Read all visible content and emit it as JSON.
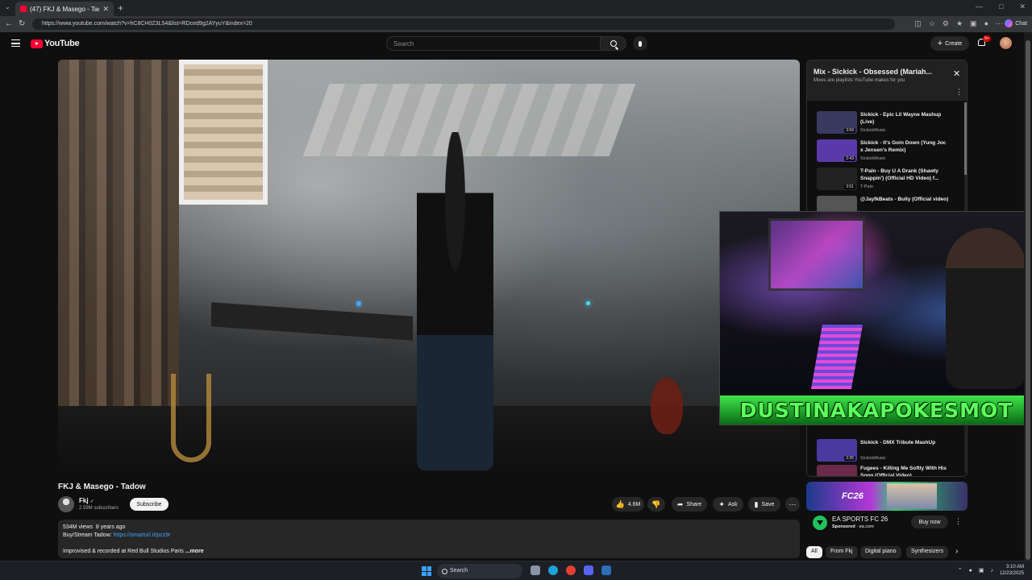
{
  "browser": {
    "tab_title": "(47) FKJ & Masego - Tadow",
    "url": "https://www.youtube.com/watch?v=hC8CH0Z3L54&list=RDced9g2AYyuY&index=20",
    "chat_label": "Chat"
  },
  "header": {
    "logo_text": "YouTube",
    "search_placeholder": "Search",
    "create_label": "Create",
    "notification_count": "9+"
  },
  "video": {
    "title": "FKJ & Masego - Tadow",
    "channel": "Fkj",
    "subscribers": "2.59M subscribers",
    "subscribe_label": "Subscribe",
    "likes": "4.6M",
    "share_label": "Share",
    "ask_label": "Ask",
    "save_label": "Save",
    "views": "534M views",
    "age": "8 years ago",
    "desc_line1": "Buy/Stream Tadow:",
    "desc_link": "https://smarturl.it/pzz9r",
    "desc_line2": "Improvised & recorded at Red Bull Studios Paris",
    "more_label": "...more"
  },
  "playlist": {
    "title": "Mix - Sickick - Obsessed (Mariah...",
    "subtitle": "Mixes are playlists YouTube makes for you",
    "items": [
      {
        "title": "Sickick - Epic Lil Wayne Mashup (Live)",
        "channel": "SickickMusic",
        "duration": "3:59",
        "thumb_color": "#3a3a60"
      },
      {
        "title": "Sickick - It's Goin Down (Yung Joc x Jensen's Remix)",
        "channel": "SickickMusic",
        "duration": "2:43",
        "thumb_color": "#5a3aa8"
      },
      {
        "title": "T-Pain - Buy U A Drank (Shawty Snappin') (Official HD Video) f...",
        "channel": "T-Pain",
        "duration": "3:51",
        "thumb_color": "#222222"
      },
      {
        "title": "@JayfkBeats - Bully (Official video)",
        "channel": "",
        "duration": "",
        "thumb_color": "#555555"
      },
      {
        "title": "Sickick - DMX Tribute MashUp",
        "channel": "SickickMusic",
        "duration": "2:25",
        "thumb_color": "#4a3aa0"
      },
      {
        "title": "Fugees - Killing Me Softly With His Song (Official Video)",
        "channel": "",
        "duration": "",
        "thumb_color": "#6a2a4a"
      }
    ],
    "hidden_duration": "3:22"
  },
  "webcam": {
    "banner_text": "DUSTINAKAPOKESMOT"
  },
  "ad": {
    "banner_text": "FC26",
    "name": "EA SPORTS FC 26",
    "sponsored": "Sponsored",
    "domain": "ea.com",
    "cta": "Buy now"
  },
  "chips": [
    "All",
    "From Fkj",
    "Digital piano",
    "Synthesizers"
  ],
  "taskbar": {
    "search_label": "Search",
    "time": "3:10 AM",
    "date": "12/23/2025"
  },
  "colors": {
    "background": "#0f0f0f",
    "youtube_red": "#ff0033",
    "link": "#3ea6ff",
    "banner_green": "#3ee44a"
  }
}
